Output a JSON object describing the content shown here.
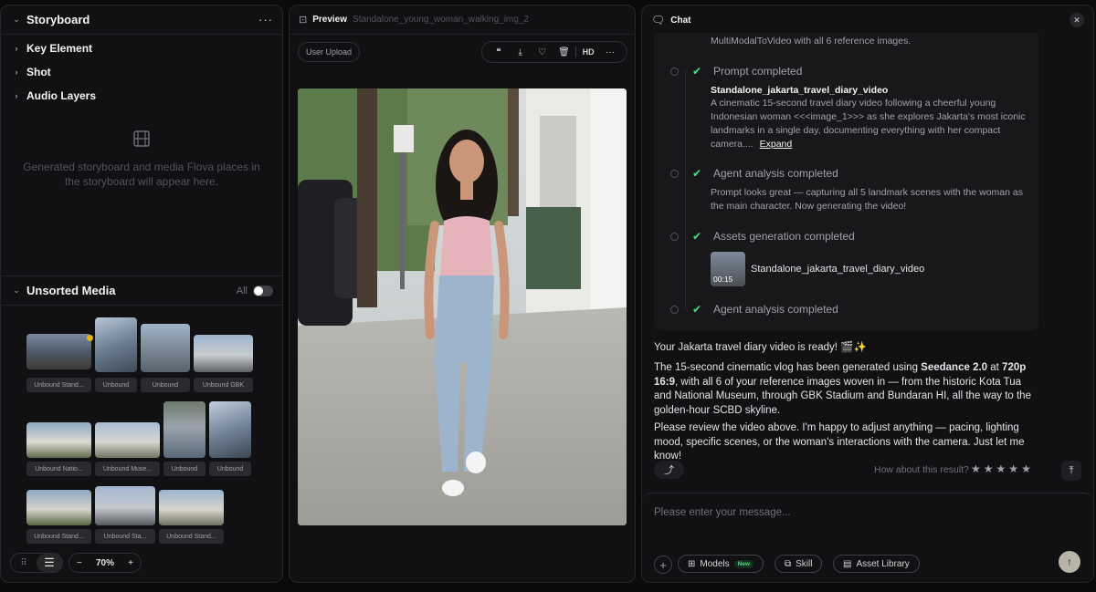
{
  "storyboard": {
    "title": "Storyboard",
    "items": [
      "Key Element",
      "Shot",
      "Audio Layers"
    ],
    "empty_text": "Generated storyboard and media Flova places in the storyboard will appear here."
  },
  "unsorted": {
    "title": "Unsorted Media",
    "filter_label": "All",
    "captions": [
      "Unbound Stand...",
      "Unbound",
      "Unbound",
      "Unbound GBK",
      "Unbound Natio...",
      "Unbound Muse...",
      "Unbound",
      "Unbound",
      "Unbound Stand...",
      "Unbound Sta...",
      "Unbound Stand..."
    ]
  },
  "bottom_bar": {
    "zoom": "70%",
    "minus": "−",
    "plus": "+"
  },
  "preview": {
    "title": "Preview",
    "filename": "Standalone_young_woman_walking_img_2",
    "source_badge": "User Upload",
    "quality": "HD"
  },
  "chat": {
    "title": "Chat",
    "top_line": "MultiModalToVideo with all 6 reference images.",
    "steps": [
      {
        "label": "Prompt completed"
      },
      {
        "label": "Agent analysis completed"
      },
      {
        "label": "Assets generation completed"
      },
      {
        "label": "Agent analysis completed"
      }
    ],
    "prompt_title": "Standalone_jakarta_travel_diary_video",
    "prompt_text": "A cinematic 15-second travel diary video following a cheerful young Indonesian woman <<<image_1>>> as she explores Jakarta's most iconic landmarks in a single day, documenting everything with her compact camera....",
    "expand": "Expand",
    "analysis_text": "Prompt looks great — capturing all 5 landmark scenes with the woman as the main character. Now generating the video!",
    "asset_duration": "00:15",
    "asset_name": "Standalone_jakarta_travel_diary_video",
    "ready_msg": "Your Jakarta travel diary video is ready! 🎬✨",
    "p1_a": "The 15-second cinematic vlog has been generated using ",
    "p1_model": "Seedance 2.0",
    "p1_b": " at ",
    "p1_res": "720p 16:9",
    "p1_c": ", with all 6 of your reference images woven in — from the historic Kota Tua and National Museum, through GBK Stadium and Bundaran HI, all the way to the golden-hour SCBD skyline.",
    "p2": "Please review the video above. I'm happy to adjust anything — pacing, lighting mood, specific scenes, or the woman's interactions with the camera. Just let me know!",
    "feedback_q": "How about this result?",
    "input_placeholder": "Please enter your message...",
    "models_label": "Models",
    "new_badge": "New",
    "skill_label": "Skill",
    "asset_library_label": "Asset Library"
  },
  "colors": {
    "accent_green": "#4ade80",
    "bg": "#0a0a0b",
    "panel": "#111113"
  }
}
